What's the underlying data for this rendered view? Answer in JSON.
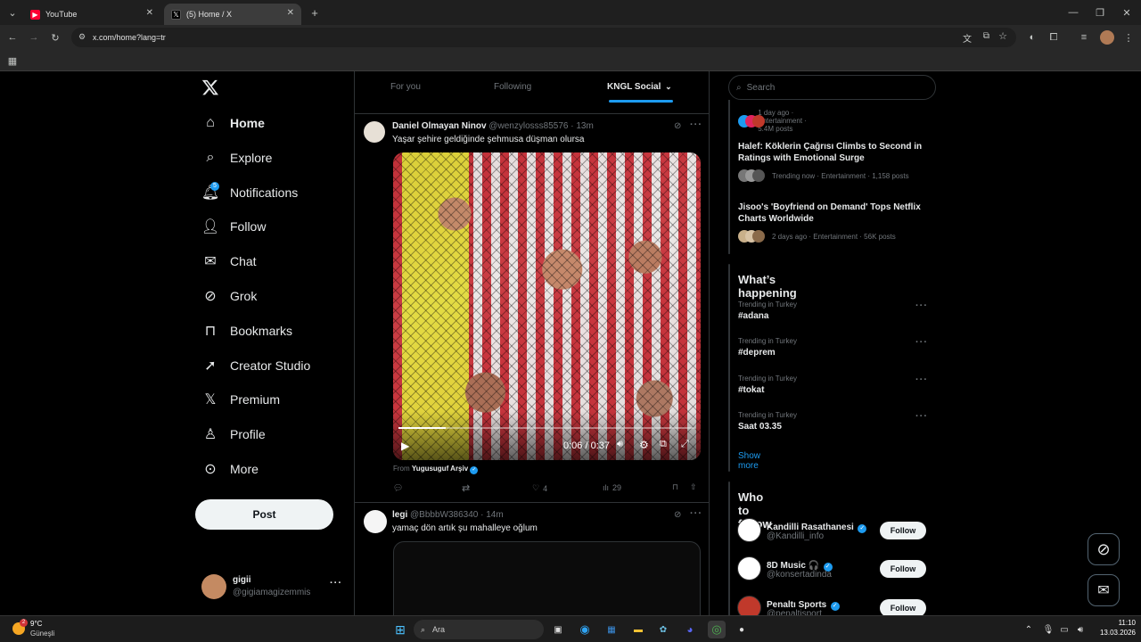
{
  "browser": {
    "tabs": [
      {
        "title": "YouTube",
        "active": false
      },
      {
        "title": "(5) Home / X",
        "active": true
      }
    ],
    "url": "x.com/home?lang=tr"
  },
  "sidebar": {
    "items": [
      {
        "label": "Home",
        "icon": "home-icon",
        "active": true
      },
      {
        "label": "Explore",
        "icon": "search-icon"
      },
      {
        "label": "Notifications",
        "icon": "bell-icon",
        "badge": "5"
      },
      {
        "label": "Follow",
        "icon": "person-add-icon"
      },
      {
        "label": "Chat",
        "icon": "mail-icon"
      },
      {
        "label": "Grok",
        "icon": "grok-icon"
      },
      {
        "label": "Bookmarks",
        "icon": "bookmark-icon"
      },
      {
        "label": "Creator Studio",
        "icon": "rocket-icon"
      },
      {
        "label": "Premium",
        "icon": "x-logo-icon"
      },
      {
        "label": "Profile",
        "icon": "person-icon"
      },
      {
        "label": "More",
        "icon": "more-circle-icon"
      }
    ],
    "post_label": "Post",
    "account": {
      "name": "gigii",
      "handle": "@gigiamagizemmis"
    }
  },
  "feed": {
    "tabs": [
      {
        "label": "For you"
      },
      {
        "label": "Following"
      },
      {
        "label": "KNGL Social",
        "active": true
      }
    ],
    "tweets": [
      {
        "name": "Daniel Olmayan Ninov",
        "handle": "@wenzylosss85576",
        "time": "· 13m",
        "text": "Yaşar şehire geldiğinde şehmusa düşman olursa",
        "video_time": "0:06 / 0:37",
        "video_progress": 0.16,
        "from_label": "From",
        "from_name": "Yugusuguf Arşiv",
        "likes": "4",
        "views": "29"
      },
      {
        "name": "legi",
        "handle": "@BbbbW386340",
        "time": "· 14m",
        "text": "yamaç dön artık şu mahalleye oğlum"
      }
    ]
  },
  "right": {
    "search_placeholder": "Search",
    "top_trends": [
      {
        "meta": "1 day ago · Entertainment · 5.4M posts"
      },
      {
        "title": "Halef: Köklerin Çağrısı Climbs to Second in Ratings with Emotional Surge",
        "meta": "Trending now · Entertainment · 1,158 posts"
      },
      {
        "title": "Jisoo's 'Boyfriend on Demand' Tops Netflix Charts Worldwide",
        "meta": "2 days ago · Entertainment · 56K posts"
      }
    ],
    "happening": {
      "title": "What’s happening",
      "items": [
        {
          "meta": "Trending in Turkey",
          "tag": "#adana"
        },
        {
          "meta": "Trending in Turkey",
          "tag": "#deprem"
        },
        {
          "meta": "Trending in Turkey",
          "tag": "#tokat"
        },
        {
          "meta": "Trending in Turkey",
          "tag": "Saat 03.35"
        }
      ],
      "show_more": "Show more"
    },
    "who_to_follow": {
      "title": "Who to follow",
      "items": [
        {
          "name": "Kandilli Rasathanesi",
          "handle": "@Kandilli_info",
          "button": "Follow"
        },
        {
          "name": "8D Music 🎧",
          "handle": "@konsertadinda",
          "button": "Follow"
        },
        {
          "name": "Penaltı Sports",
          "handle": "@penaltisport",
          "button": "Follow"
        }
      ]
    }
  },
  "taskbar": {
    "weather_temp": "9°C",
    "weather_desc": "Güneşli",
    "weather_badge": "2",
    "search_placeholder": "Ara",
    "time": "11:10",
    "date": "13.03.2026"
  },
  "colors": {
    "accent": "#1d9bf0",
    "bg": "#000000",
    "border": "#2f3336",
    "muted": "#71767b"
  }
}
